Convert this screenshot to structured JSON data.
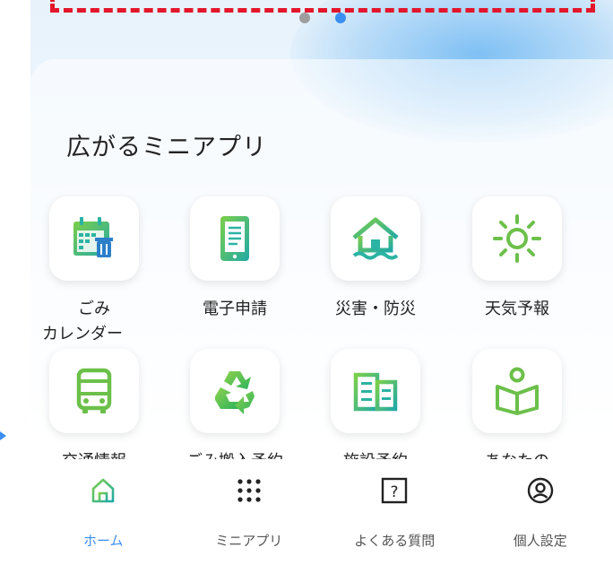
{
  "carousel": {
    "page_count": 2,
    "active_index": 1
  },
  "section": {
    "title": "広がるミニアプリ"
  },
  "apps": [
    {
      "label_line1": "ごみ",
      "label_line2": "カレンダー",
      "icon": "calendar-trash-icon"
    },
    {
      "label_line1": "電子申請",
      "label_line2": "",
      "icon": "document-tablet-icon"
    },
    {
      "label_line1": "災害・防災",
      "label_line2": "",
      "icon": "house-flood-icon"
    },
    {
      "label_line1": "天気予報",
      "label_line2": "",
      "icon": "sun-icon"
    },
    {
      "label_line1": "交通情報",
      "label_line2": "",
      "icon": "bus-icon"
    },
    {
      "label_line1": "ごみ搬入予約",
      "label_line2": "",
      "icon": "recycle-icon"
    },
    {
      "label_line1": "施設予約",
      "label_line2": "",
      "icon": "building-icon"
    },
    {
      "label_line1": "あなたの",
      "label_line2": "",
      "icon": "person-book-icon"
    }
  ],
  "bottom_nav": [
    {
      "label": "ホーム",
      "icon": "home-icon",
      "active": true
    },
    {
      "label": "ミニアプリ",
      "icon": "grid-dots-icon",
      "active": false
    },
    {
      "label": "よくある質問",
      "icon": "question-box-icon",
      "active": false
    },
    {
      "label": "個人設定",
      "icon": "user-circle-icon",
      "active": false
    }
  ],
  "colors": {
    "accent_blue": "#3a8ff0",
    "icon_green": "#6cc04a",
    "icon_teal": "#2bb3a3",
    "banner_outline_red": "#e3162b",
    "text_dark": "#222222"
  }
}
